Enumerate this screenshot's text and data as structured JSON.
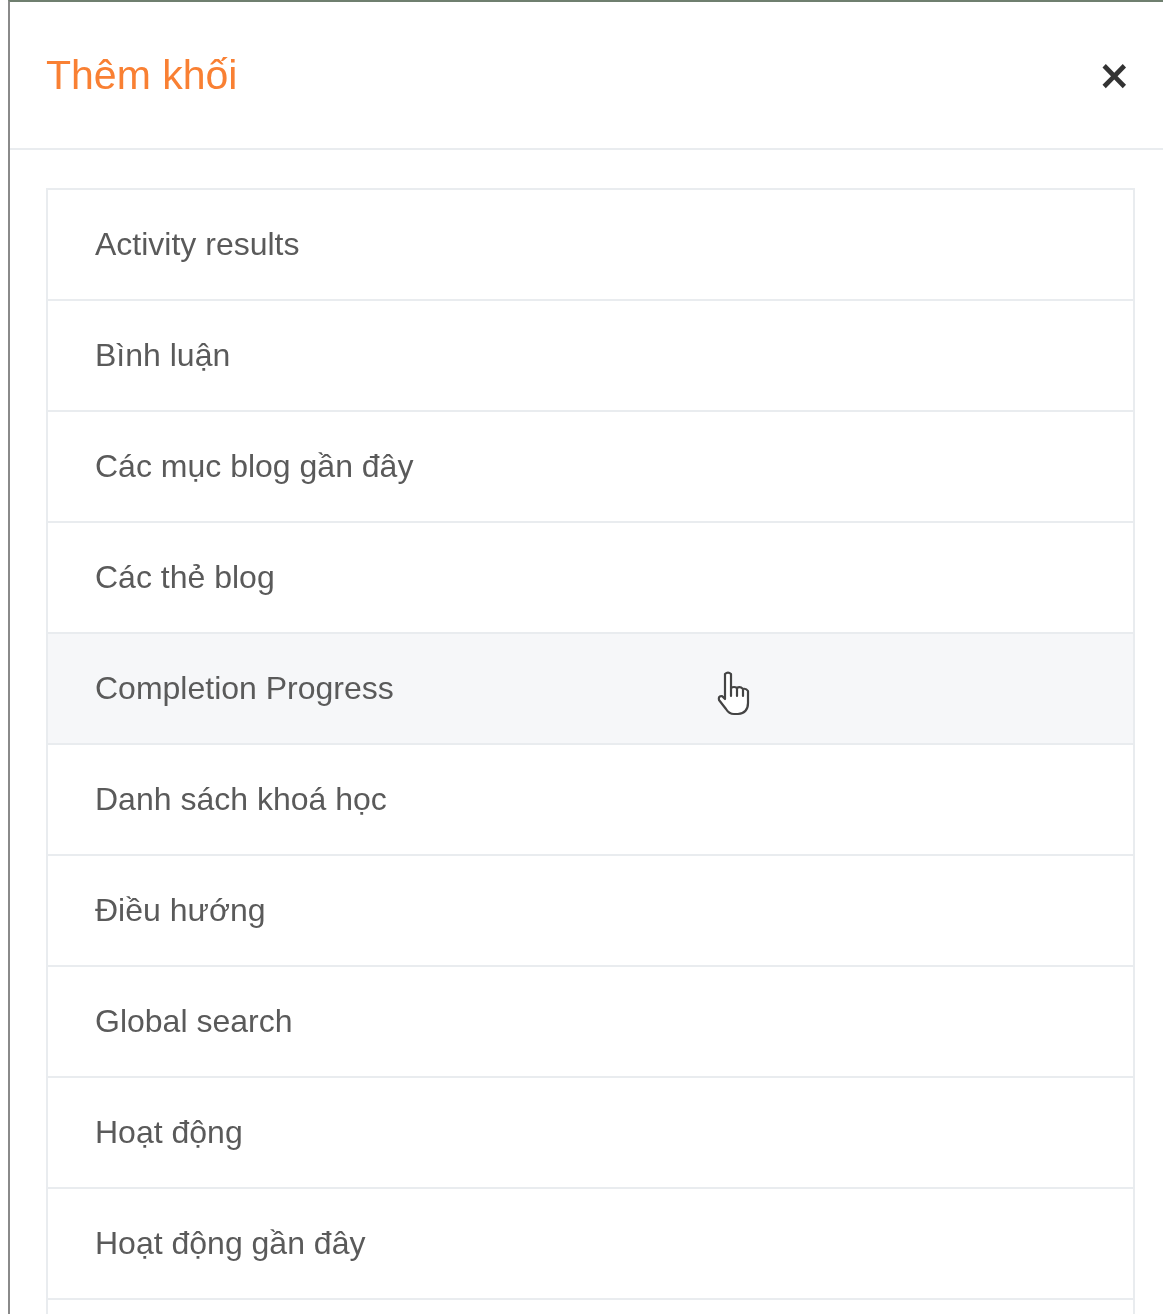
{
  "dialog": {
    "title": "Thêm khối",
    "close": "×"
  },
  "blocks": [
    {
      "label": "Activity results",
      "highlighted": false
    },
    {
      "label": "Bình luận",
      "highlighted": false
    },
    {
      "label": "Các mục blog gần đây",
      "highlighted": false
    },
    {
      "label": "Các thẻ blog",
      "highlighted": false
    },
    {
      "label": "Completion Progress",
      "highlighted": true
    },
    {
      "label": "Danh sách khoá học",
      "highlighted": false
    },
    {
      "label": "Điều hướng",
      "highlighted": false
    },
    {
      "label": "Global search",
      "highlighted": false
    },
    {
      "label": "Hoạt động",
      "highlighted": false
    },
    {
      "label": "Hoạt động gần đây",
      "highlighted": false
    }
  ]
}
